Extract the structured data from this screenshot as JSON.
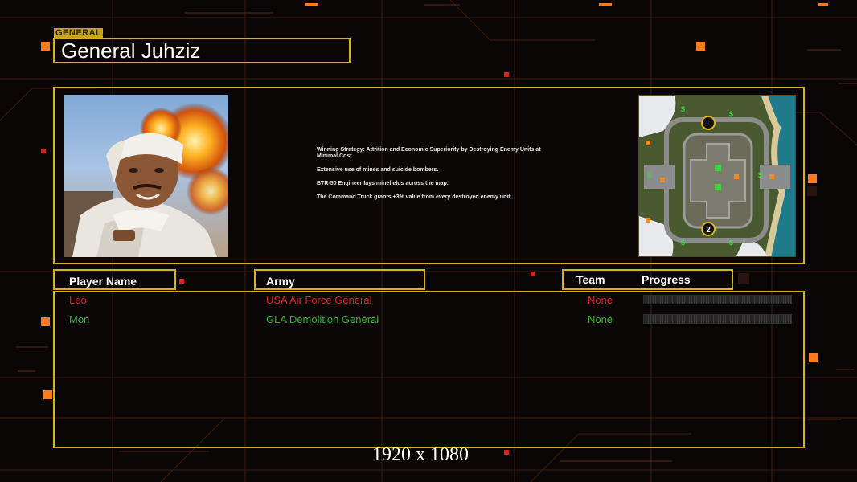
{
  "general_tag": "GENERAL",
  "general_name": "General Juhziz",
  "strategy": {
    "line1": "Winning Strategy: Attrition and Economic Superiority by Destroying Enemy Units at Minimal Cost",
    "line2": "Extensive use of mines and suicide bombers.",
    "line3": "BTR-50 Engineer lays minefields across the map.",
    "line4": "The Command Truck grants +3% value from every destroyed enemy unit."
  },
  "minimap": {
    "icon": "map-thumbnail-icon",
    "marker_2": "2",
    "supply_symbol": "$"
  },
  "headers": {
    "player_name": "Player Name",
    "army": "Army",
    "team": "Team",
    "progress": "Progress"
  },
  "players": [
    {
      "name": "Leo",
      "army": "USA Air Force General",
      "team": "None",
      "color": "#d8241c"
    },
    {
      "name": "Mon",
      "army": "GLA Demolition General",
      "team": "None",
      "color": "#33b52a"
    }
  ],
  "resolution": "1920 x 1080",
  "colors": {
    "frame": "#d9b21f",
    "accent": "#ff7a1a",
    "background": "#0a0606"
  }
}
